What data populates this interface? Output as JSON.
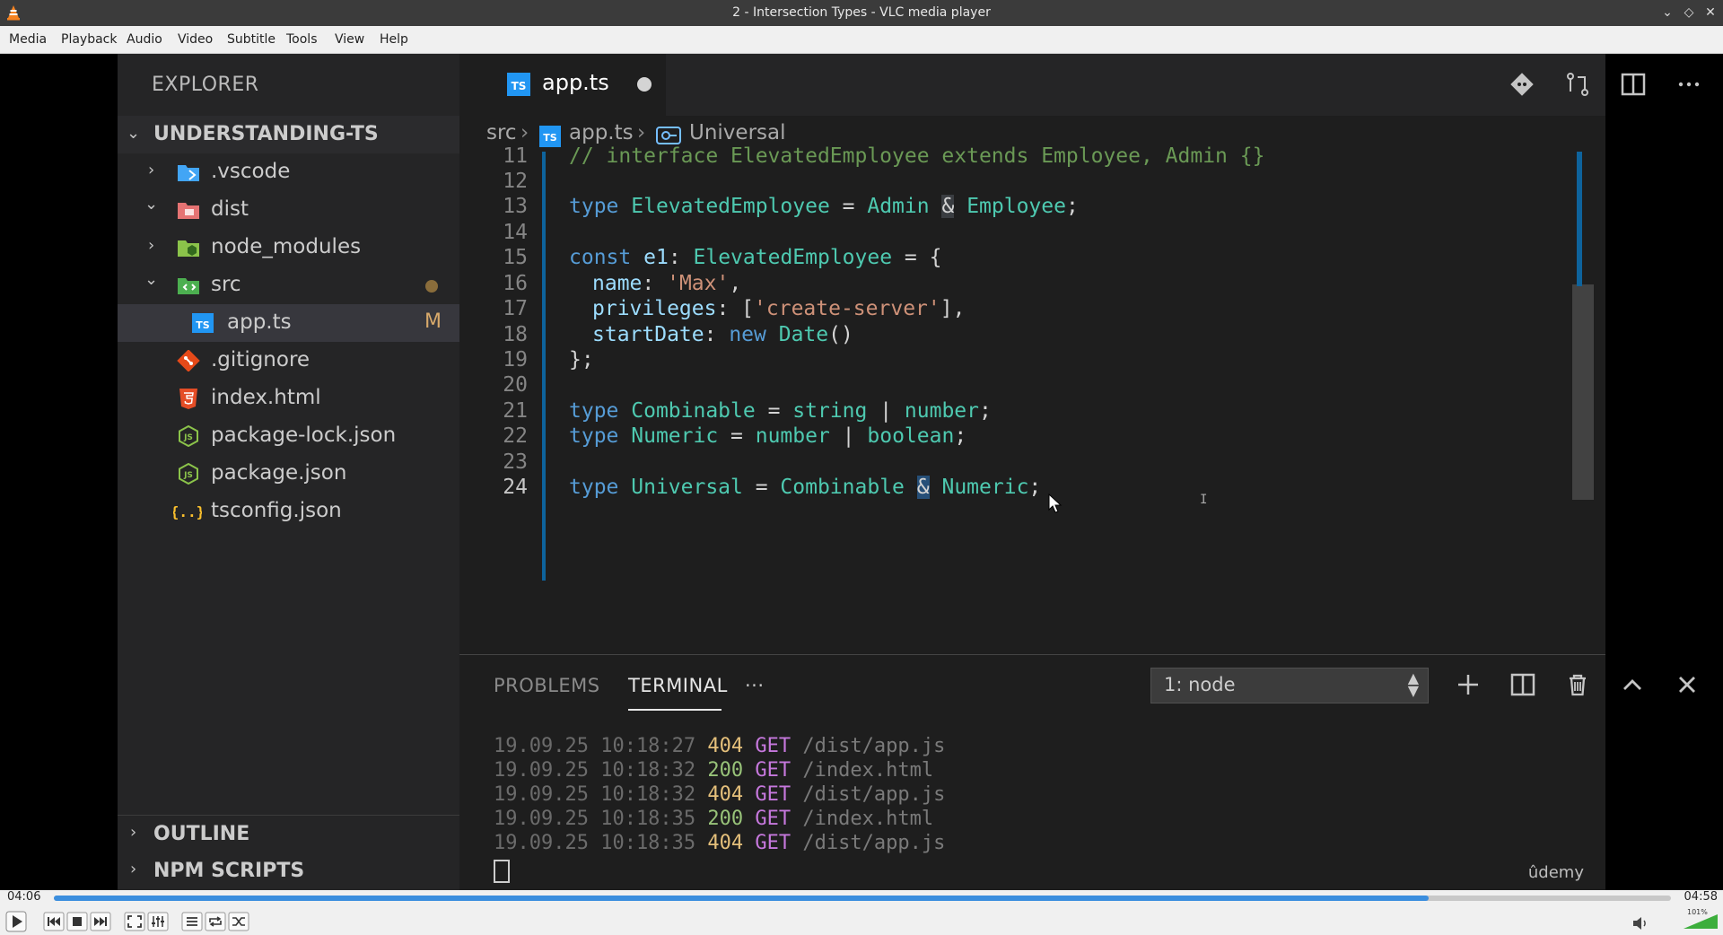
{
  "window": {
    "title": "2 - Intersection Types - VLC media player"
  },
  "menu": [
    "Media",
    "Playback",
    "Audio",
    "Video",
    "Subtitle",
    "Tools",
    "View",
    "Help"
  ],
  "sidebar": {
    "title": "EXPLORER",
    "project": "UNDERSTANDING-TS",
    "items": [
      {
        "label": ".vscode",
        "icon": "folder-vscode-icon",
        "color": "#42a5f5"
      },
      {
        "label": "dist",
        "icon": "folder-dist-icon",
        "color": "#e57373"
      },
      {
        "label": "node_modules",
        "icon": "folder-node-icon",
        "color": "#8bc34a"
      },
      {
        "label": "src",
        "icon": "folder-src-icon",
        "color": "#4caf50"
      },
      {
        "label": "app.ts",
        "icon": "typescript-icon",
        "badge": "M",
        "color": "#2196f3"
      },
      {
        "label": ".gitignore",
        "icon": "git-icon",
        "color": "#e64a19"
      },
      {
        "label": "index.html",
        "icon": "html5-icon",
        "color": "#e44d26"
      },
      {
        "label": "package-lock.json",
        "icon": "nodejs-icon",
        "color": "#8bc34a"
      },
      {
        "label": "package.json",
        "icon": "nodejs-icon",
        "color": "#8bc34a"
      },
      {
        "label": "tsconfig.json",
        "icon": "json-braces-icon",
        "color": "#fbc02d"
      }
    ],
    "outline": "OUTLINE",
    "npm_scripts": "NPM SCRIPTS"
  },
  "editor": {
    "tab": "app.ts",
    "tab_icon_text": "TS",
    "breadcrumb": [
      "src",
      "app.ts",
      "Universal"
    ],
    "line_numbers": [
      "11",
      "12",
      "13",
      "14",
      "15",
      "16",
      "17",
      "18",
      "19",
      "20",
      "21",
      "22",
      "23",
      "24"
    ],
    "lines": {
      "l11": "// interface ElevatedEmployee extends Employee, Admin {}",
      "l13_kw": "type",
      "l13_name": "ElevatedEmployee",
      "l13_eq": " = ",
      "l13_a": "Admin",
      "l13_amp": "&",
      "l13_b": "Employee",
      "l13_end": ";",
      "l15_kw": "const",
      "l15_var": "e1",
      "l15_colon": ": ",
      "l15_type": "ElevatedEmployee",
      "l15_end": " = {",
      "l16_key": "name",
      "l16_val": "'Max'",
      "l17_key": "privileges",
      "l17_open": ": [",
      "l17_val": "'create-server'",
      "l17_close": "],",
      "l18_key": "startDate",
      "l18_new": "new",
      "l18_ctor": "Date",
      "l18_call": "()",
      "l19": "};",
      "l21_kw": "type",
      "l21_name": "Combinable",
      "l21_eq": " = ",
      "l21_a": "string",
      "l21_pipe": " | ",
      "l21_b": "number",
      "l21_end": ";",
      "l22_kw": "type",
      "l22_name": "Numeric",
      "l22_eq": " = ",
      "l22_a": "number",
      "l22_pipe": " | ",
      "l22_b": "boolean",
      "l22_end": ";",
      "l24_kw": "type",
      "l24_name": "Universal",
      "l24_eq": " = ",
      "l24_a": "Combinable",
      "l24_amp": "&",
      "l24_b": "Numeric",
      "l24_end": ";"
    }
  },
  "panel": {
    "tabs": [
      "PROBLEMS",
      "TERMINAL",
      "···"
    ],
    "terminal_select": "1: node",
    "log": [
      {
        "ts": "19.09.25 10:18:27",
        "status": "404",
        "method": "GET",
        "path": "/dist/app.js"
      },
      {
        "ts": "19.09.25 10:18:32",
        "status": "200",
        "method": "GET",
        "path": "/index.html"
      },
      {
        "ts": "19.09.25 10:18:32",
        "status": "404",
        "method": "GET",
        "path": "/dist/app.js"
      },
      {
        "ts": "19.09.25 10:18:35",
        "status": "200",
        "method": "GET",
        "path": "/index.html"
      },
      {
        "ts": "19.09.25 10:18:35",
        "status": "404",
        "method": "GET",
        "path": "/dist/app.js"
      }
    ],
    "watermark": "ûdemy"
  },
  "player": {
    "time_current": "04:06",
    "time_total": "04:58",
    "progress_fraction": 0.85,
    "volume_label": "101%",
    "volume_fraction": 1.0,
    "accent": "#3b8ede"
  }
}
